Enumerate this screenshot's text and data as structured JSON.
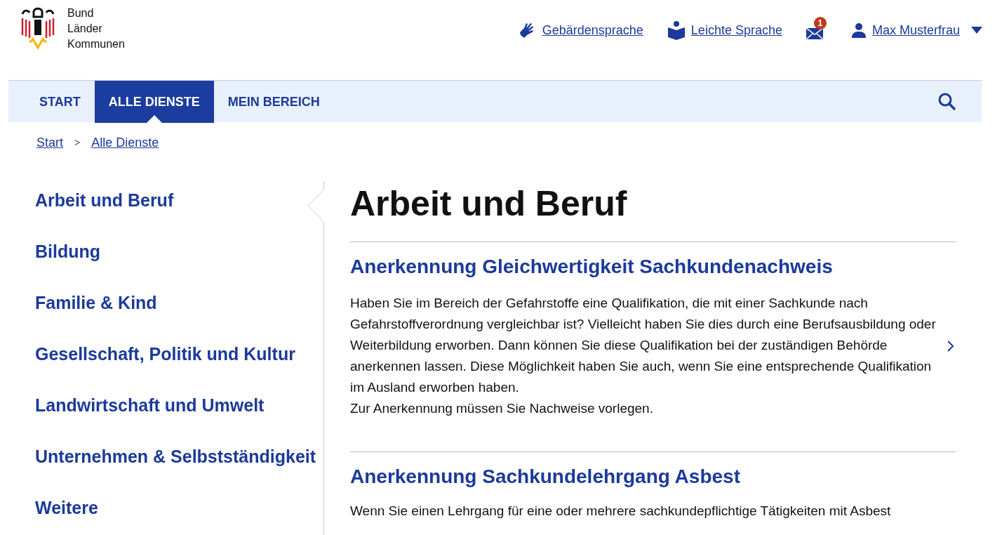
{
  "logo": {
    "lines": [
      "Bund",
      "Länder",
      "Kommunen"
    ]
  },
  "header_links": [
    {
      "kind": "sign",
      "label": "Gebärdensprache"
    },
    {
      "kind": "book",
      "label": "Leichte Sprache"
    }
  ],
  "messages": {
    "badge": "1"
  },
  "user": {
    "name": "Max Musterfrau"
  },
  "nav": {
    "tabs": [
      {
        "label": "START",
        "selected": false
      },
      {
        "label": "ALLE DIENSTE",
        "selected": true
      },
      {
        "label": "MEIN BEREICH",
        "selected": false
      }
    ]
  },
  "breadcrumb": {
    "items": [
      "Start",
      "Alle Dienste"
    ],
    "separators": [
      ">"
    ]
  },
  "sidebar": {
    "items": [
      {
        "label": "Arbeit und Beruf",
        "selected": true
      },
      {
        "label": "Bildung",
        "selected": false
      },
      {
        "label": "Familie & Kind",
        "selected": false
      },
      {
        "label": "Gesellschaft, Politik und Kultur",
        "selected": false
      },
      {
        "label": "Landwirtschaft und Umwelt",
        "selected": false
      },
      {
        "label": "Unternehmen & Selbstständigkeit",
        "selected": false
      },
      {
        "label": "Weitere",
        "selected": false
      }
    ]
  },
  "page_title": "Arbeit und Beruf",
  "services": [
    {
      "title": "Anerkennung Gleichwertigkeit Sachkundenachweis",
      "paragraphs": [
        "Haben Sie im Bereich der Gefahrstoffe eine Qualifikation, die mit einer Sachkunde nach Gefahrstoffverordnung vergleichbar ist? Vielleicht haben Sie dies durch eine Berufsausbildung oder Weiterbildung erworben. Dann können Sie diese Qualifikation bei der zuständigen Behörde anerkennen lassen. Diese Möglichkeit haben Sie auch, wenn Sie eine entsprechende Qualifikation im Ausland erworben haben.",
        "Zur Anerkennung müssen Sie Nachweise vorlegen."
      ]
    },
    {
      "title": "Anerkennung Sachkundelehrgang Asbest",
      "paragraphs": [
        "Wenn Sie einen Lehrgang für eine oder mehrere sachkundepflichtige Tätigkeiten mit Asbest"
      ]
    }
  ]
}
